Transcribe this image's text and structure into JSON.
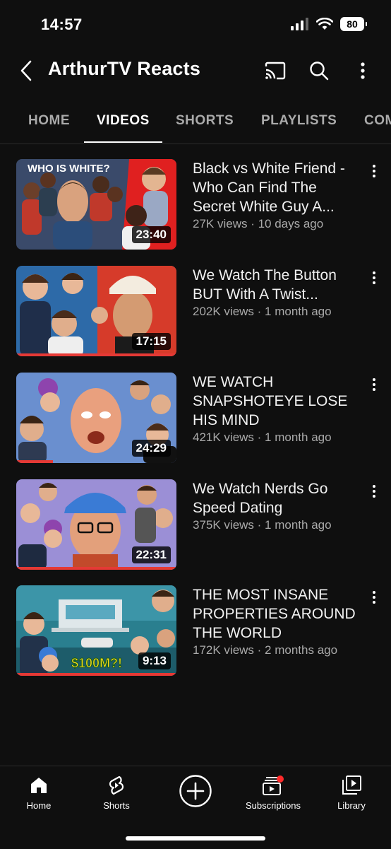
{
  "status": {
    "time": "14:57",
    "battery": "80"
  },
  "header": {
    "title": "ArthurTV Reacts"
  },
  "tabs": [
    {
      "label": "HOME"
    },
    {
      "label": "VIDEOS"
    },
    {
      "label": "SHORTS"
    },
    {
      "label": "PLAYLISTS"
    },
    {
      "label": "COM"
    }
  ],
  "videos": [
    {
      "title": "Black vs White Friend - Who Can Find The Secret White Guy A...",
      "meta": "27K views · 10 days ago",
      "duration": "23:40",
      "thumb_text": "WHO IS WHITE?",
      "progress": 0
    },
    {
      "title": "We Watch The Button BUT With A Twist...",
      "meta": "202K views · 1 month ago",
      "duration": "17:15",
      "thumb_text": "",
      "progress": 1.0
    },
    {
      "title": "WE WATCH SNAPSHOTEYE LOSE HIS MIND",
      "meta": "421K views · 1 month ago",
      "duration": "24:29",
      "thumb_text": "",
      "progress": 0.23
    },
    {
      "title": "We Watch Nerds Go Speed Dating",
      "meta": "375K views · 1 month ago",
      "duration": "22:31",
      "thumb_text": "",
      "progress": 1.0
    },
    {
      "title": "THE MOST INSANE PROPERTIES AROUND THE WORLD",
      "meta": "172K views · 2 months ago",
      "duration": "9:13",
      "thumb_text": "$100M?!",
      "progress": 1.0
    }
  ],
  "bottom_nav": [
    {
      "label": "Home",
      "icon": "home-icon"
    },
    {
      "label": "Shorts",
      "icon": "shorts-icon"
    },
    {
      "label": "",
      "icon": "create-icon"
    },
    {
      "label": "Subscriptions",
      "icon": "subscriptions-icon"
    },
    {
      "label": "Library",
      "icon": "library-icon"
    }
  ],
  "colors": {
    "background": "#0f0f0f",
    "progress": "#e53935",
    "muted_text": "#aaaaaa"
  }
}
